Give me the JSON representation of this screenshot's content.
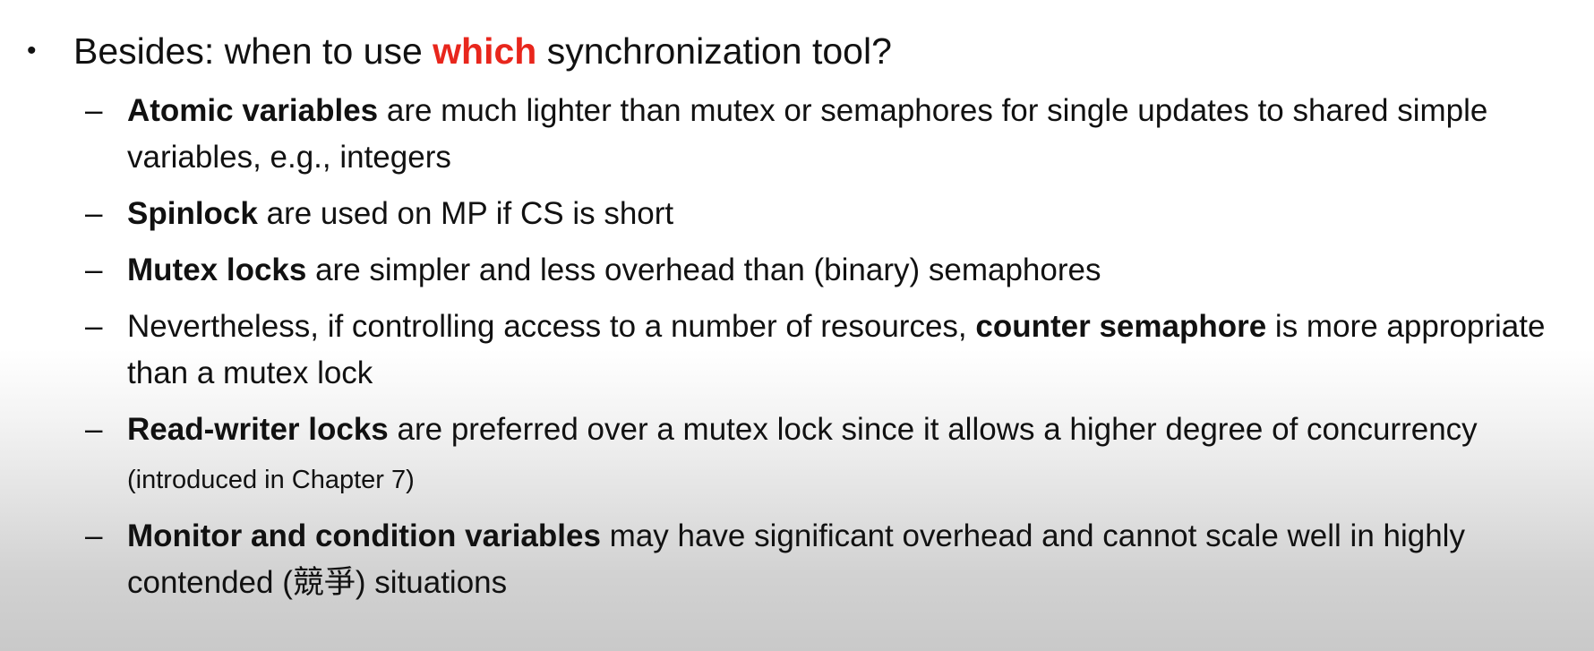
{
  "slide": {
    "main_bullet": {
      "symbol": "•",
      "prefix": "Besides: when to use ",
      "highlight": "which",
      "suffix": " synchronization tool?"
    },
    "dash_symbol": "–",
    "items": [
      {
        "bold": "Atomic variables",
        "text": " are much lighter than mutex or semaphores for single updates to shared simple variables, e.g., integers"
      },
      {
        "bold": "Spinlock",
        "text": " are used on MP if CS is short"
      },
      {
        "bold": "Mutex locks",
        "text": " are simpler and less overhead than (binary) semaphores"
      },
      {
        "before": "Nevertheless, if controlling access to a number of resources, ",
        "bold": "counter semaphore",
        "after": " is more appropriate than a mutex lock"
      },
      {
        "bold": "Read-writer locks",
        "text": " are preferred over a mutex lock since it allows a higher degree of concurrency",
        "note": " (introduced in Chapter 7)"
      },
      {
        "bold": "Monitor and condition variables",
        "text": " may have significant overhead and cannot scale well in highly contended (",
        "cjk": "競爭",
        "tail": ") situations"
      }
    ]
  },
  "colors": {
    "text": "#111111",
    "highlight": "#e8261c"
  }
}
